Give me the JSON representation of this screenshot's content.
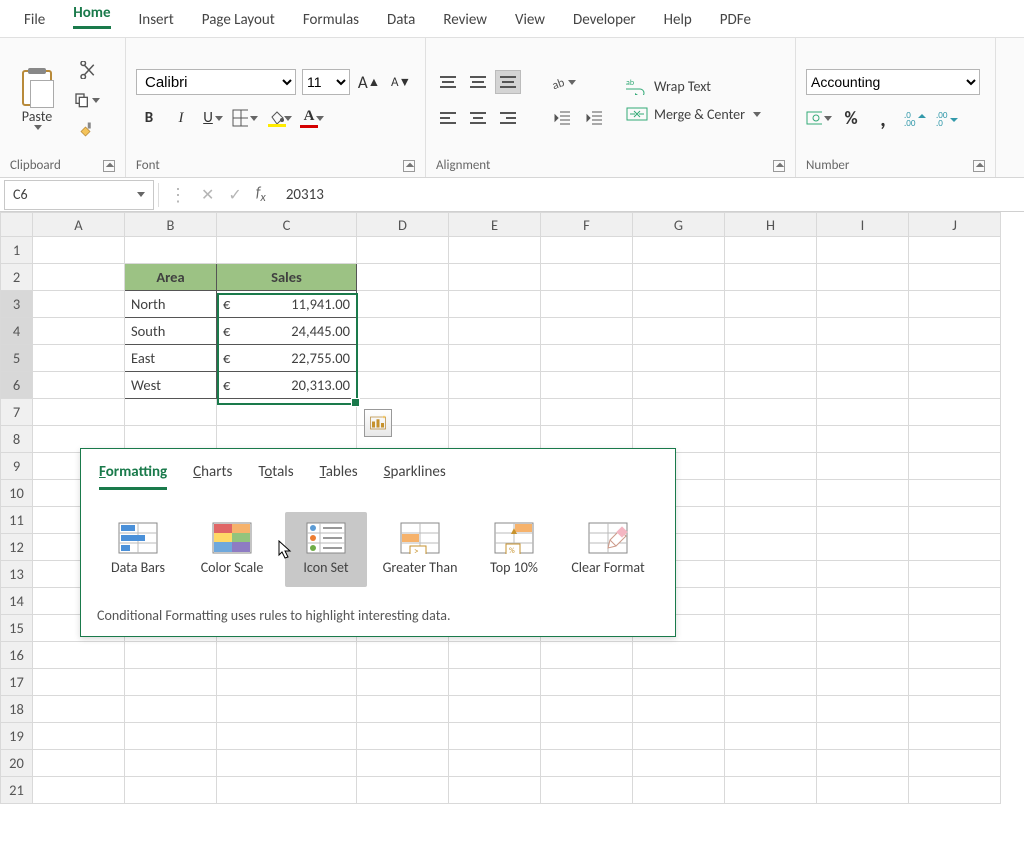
{
  "tabs": {
    "file": "File",
    "home": "Home",
    "insert": "Insert",
    "page_layout": "Page Layout",
    "formulas": "Formulas",
    "data": "Data",
    "review": "Review",
    "view": "View",
    "developer": "Developer",
    "help": "Help",
    "pdf": "PDFe"
  },
  "clipboard": {
    "paste": "Paste",
    "label": "Clipboard"
  },
  "font": {
    "name": "Calibri",
    "size": "11",
    "label": "Font",
    "bold": "B",
    "italic": "I",
    "underline": "U",
    "grow": "A",
    "shrink": "A"
  },
  "alignment": {
    "label": "Alignment",
    "wrap": "Wrap Text",
    "merge": "Merge & Center"
  },
  "number": {
    "format": "Accounting",
    "label": "Number",
    "percent": "%",
    "comma": ","
  },
  "namebox": "C6",
  "formula_value": "20313",
  "columns": [
    "A",
    "B",
    "C",
    "D",
    "E",
    "F",
    "G",
    "H",
    "I",
    "J"
  ],
  "rows": [
    "1",
    "2",
    "3",
    "4",
    "5",
    "6",
    "7",
    "8",
    "9",
    "10",
    "11",
    "12",
    "13",
    "14",
    "15",
    "16",
    "17",
    "18",
    "19",
    "20",
    "21"
  ],
  "table": {
    "hdr_area": "Area",
    "hdr_sales": "Sales",
    "currency": "€",
    "r1_area": "North",
    "r1_sales": "11,941.00",
    "r2_area": "South",
    "r2_sales": "24,445.00",
    "r3_area": "East",
    "r3_sales": "22,755.00",
    "r4_area": "West",
    "r4_sales": "20,313.00"
  },
  "qa": {
    "tabs": {
      "formatting": "ormatting",
      "charts": "harts",
      "totals": "otals",
      "tables": "ables",
      "sparklines": "parklines",
      "formatting_u": "F",
      "charts_u": "C",
      "totals_u": "T",
      "tables_u": "T",
      "sparklines_u": "S"
    },
    "opts": {
      "databars": "Data Bars",
      "colorscale": "Color Scale",
      "iconset": "Icon Set",
      "greater": "Greater Than",
      "top10": "Top 10%",
      "clear": "Clear Format"
    },
    "desc": "Conditional Formatting uses rules to highlight interesting data."
  },
  "chart_data": {
    "type": "table",
    "columns": [
      "Area",
      "Sales"
    ],
    "rows": [
      [
        "North",
        11941.0
      ],
      [
        "South",
        24445.0
      ],
      [
        "East",
        22755.0
      ],
      [
        "West",
        20313.0
      ]
    ],
    "currency": "EUR"
  }
}
